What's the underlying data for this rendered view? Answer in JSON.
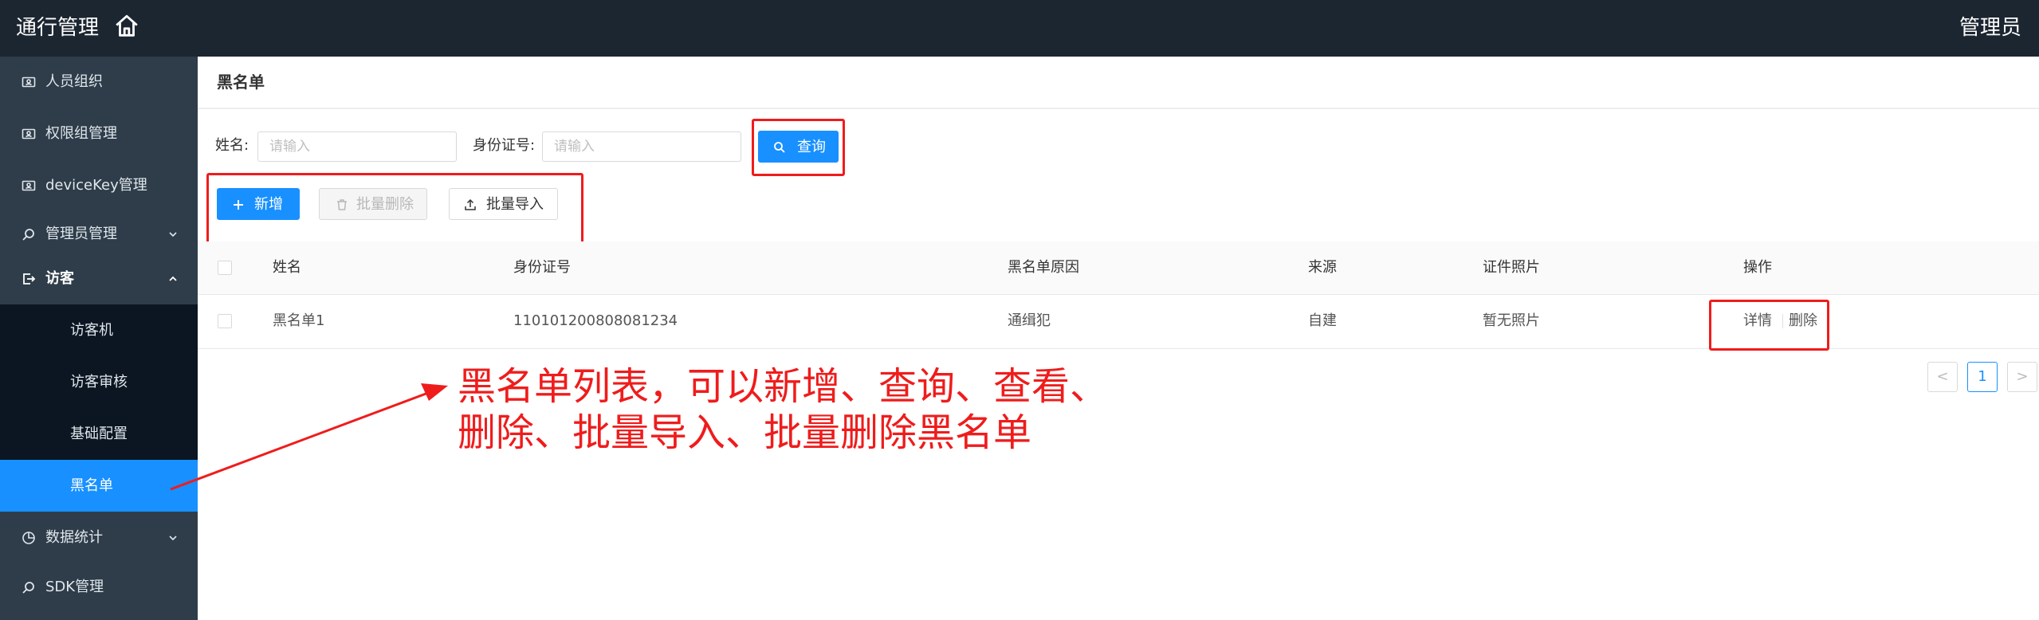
{
  "header": {
    "title": "通行管理",
    "home_icon": "home-icon",
    "user": "管理员"
  },
  "sidebar": {
    "items": [
      {
        "label": "人员组织",
        "icon": "id-card-icon"
      },
      {
        "label": "权限组管理",
        "icon": "id-card-icon"
      },
      {
        "label": "deviceKey管理",
        "icon": "id-card-icon"
      },
      {
        "label": "管理员管理",
        "icon": "search-icon"
      },
      {
        "label": "访客",
        "icon": "logout-icon"
      },
      {
        "label": "数据统计",
        "icon": "pie-chart-icon"
      },
      {
        "label": "SDK管理",
        "icon": "search-icon"
      }
    ],
    "submenu": [
      {
        "label": "访客机"
      },
      {
        "label": "访客审核"
      },
      {
        "label": "基础配置"
      },
      {
        "label": "黑名单",
        "active": true
      }
    ]
  },
  "page": {
    "title": "黑名单"
  },
  "search": {
    "name_label": "姓名:",
    "name_placeholder": "请输入",
    "id_label": "身份证号:",
    "id_placeholder": "请输入",
    "query_button": "查询"
  },
  "actions": {
    "add": "新增",
    "batch_delete": "批量删除",
    "batch_import": "批量导入"
  },
  "table": {
    "columns": [
      "姓名",
      "身份证号",
      "黑名单原因",
      "来源",
      "证件照片",
      "操作"
    ],
    "rows": [
      {
        "name": "黑名单1",
        "id_number": "110101200808081234",
        "reason": "通缉犯",
        "source": "自建",
        "photo": "暂无照片",
        "detail": "详情",
        "delete": "删除"
      }
    ]
  },
  "pagination": {
    "prev": "<",
    "current": "1",
    "next": ">"
  },
  "annotation": {
    "line1": "黑名单列表，可以新增、查询、查看、",
    "line2": "删除、批量导入、批量删除黑名单"
  },
  "colors": {
    "primary": "#1890ff",
    "topbar": "#1c2631",
    "sidebar": "#2f3d4a",
    "submenu": "#0b1622",
    "annotation": "#ef1c1c"
  }
}
